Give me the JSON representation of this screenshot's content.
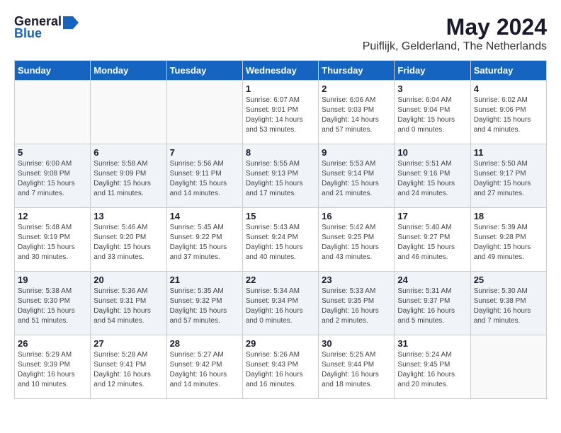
{
  "logo": {
    "line1": "General",
    "line2": "Blue"
  },
  "title": "May 2024",
  "subtitle": "Puiflijk, Gelderland, The Netherlands",
  "headers": [
    "Sunday",
    "Monday",
    "Tuesday",
    "Wednesday",
    "Thursday",
    "Friday",
    "Saturday"
  ],
  "weeks": [
    [
      {
        "day": "",
        "info": ""
      },
      {
        "day": "",
        "info": ""
      },
      {
        "day": "",
        "info": ""
      },
      {
        "day": "1",
        "info": "Sunrise: 6:07 AM\nSunset: 9:01 PM\nDaylight: 14 hours\nand 53 minutes."
      },
      {
        "day": "2",
        "info": "Sunrise: 6:06 AM\nSunset: 9:03 PM\nDaylight: 14 hours\nand 57 minutes."
      },
      {
        "day": "3",
        "info": "Sunrise: 6:04 AM\nSunset: 9:04 PM\nDaylight: 15 hours\nand 0 minutes."
      },
      {
        "day": "4",
        "info": "Sunrise: 6:02 AM\nSunset: 9:06 PM\nDaylight: 15 hours\nand 4 minutes."
      }
    ],
    [
      {
        "day": "5",
        "info": "Sunrise: 6:00 AM\nSunset: 9:08 PM\nDaylight: 15 hours\nand 7 minutes."
      },
      {
        "day": "6",
        "info": "Sunrise: 5:58 AM\nSunset: 9:09 PM\nDaylight: 15 hours\nand 11 minutes."
      },
      {
        "day": "7",
        "info": "Sunrise: 5:56 AM\nSunset: 9:11 PM\nDaylight: 15 hours\nand 14 minutes."
      },
      {
        "day": "8",
        "info": "Sunrise: 5:55 AM\nSunset: 9:13 PM\nDaylight: 15 hours\nand 17 minutes."
      },
      {
        "day": "9",
        "info": "Sunrise: 5:53 AM\nSunset: 9:14 PM\nDaylight: 15 hours\nand 21 minutes."
      },
      {
        "day": "10",
        "info": "Sunrise: 5:51 AM\nSunset: 9:16 PM\nDaylight: 15 hours\nand 24 minutes."
      },
      {
        "day": "11",
        "info": "Sunrise: 5:50 AM\nSunset: 9:17 PM\nDaylight: 15 hours\nand 27 minutes."
      }
    ],
    [
      {
        "day": "12",
        "info": "Sunrise: 5:48 AM\nSunset: 9:19 PM\nDaylight: 15 hours\nand 30 minutes."
      },
      {
        "day": "13",
        "info": "Sunrise: 5:46 AM\nSunset: 9:20 PM\nDaylight: 15 hours\nand 33 minutes."
      },
      {
        "day": "14",
        "info": "Sunrise: 5:45 AM\nSunset: 9:22 PM\nDaylight: 15 hours\nand 37 minutes."
      },
      {
        "day": "15",
        "info": "Sunrise: 5:43 AM\nSunset: 9:24 PM\nDaylight: 15 hours\nand 40 minutes."
      },
      {
        "day": "16",
        "info": "Sunrise: 5:42 AM\nSunset: 9:25 PM\nDaylight: 15 hours\nand 43 minutes."
      },
      {
        "day": "17",
        "info": "Sunrise: 5:40 AM\nSunset: 9:27 PM\nDaylight: 15 hours\nand 46 minutes."
      },
      {
        "day": "18",
        "info": "Sunrise: 5:39 AM\nSunset: 9:28 PM\nDaylight: 15 hours\nand 49 minutes."
      }
    ],
    [
      {
        "day": "19",
        "info": "Sunrise: 5:38 AM\nSunset: 9:30 PM\nDaylight: 15 hours\nand 51 minutes."
      },
      {
        "day": "20",
        "info": "Sunrise: 5:36 AM\nSunset: 9:31 PM\nDaylight: 15 hours\nand 54 minutes."
      },
      {
        "day": "21",
        "info": "Sunrise: 5:35 AM\nSunset: 9:32 PM\nDaylight: 15 hours\nand 57 minutes."
      },
      {
        "day": "22",
        "info": "Sunrise: 5:34 AM\nSunset: 9:34 PM\nDaylight: 16 hours\nand 0 minutes."
      },
      {
        "day": "23",
        "info": "Sunrise: 5:33 AM\nSunset: 9:35 PM\nDaylight: 16 hours\nand 2 minutes."
      },
      {
        "day": "24",
        "info": "Sunrise: 5:31 AM\nSunset: 9:37 PM\nDaylight: 16 hours\nand 5 minutes."
      },
      {
        "day": "25",
        "info": "Sunrise: 5:30 AM\nSunset: 9:38 PM\nDaylight: 16 hours\nand 7 minutes."
      }
    ],
    [
      {
        "day": "26",
        "info": "Sunrise: 5:29 AM\nSunset: 9:39 PM\nDaylight: 16 hours\nand 10 minutes."
      },
      {
        "day": "27",
        "info": "Sunrise: 5:28 AM\nSunset: 9:41 PM\nDaylight: 16 hours\nand 12 minutes."
      },
      {
        "day": "28",
        "info": "Sunrise: 5:27 AM\nSunset: 9:42 PM\nDaylight: 16 hours\nand 14 minutes."
      },
      {
        "day": "29",
        "info": "Sunrise: 5:26 AM\nSunset: 9:43 PM\nDaylight: 16 hours\nand 16 minutes."
      },
      {
        "day": "30",
        "info": "Sunrise: 5:25 AM\nSunset: 9:44 PM\nDaylight: 16 hours\nand 18 minutes."
      },
      {
        "day": "31",
        "info": "Sunrise: 5:24 AM\nSunset: 9:45 PM\nDaylight: 16 hours\nand 20 minutes."
      },
      {
        "day": "",
        "info": ""
      }
    ]
  ]
}
